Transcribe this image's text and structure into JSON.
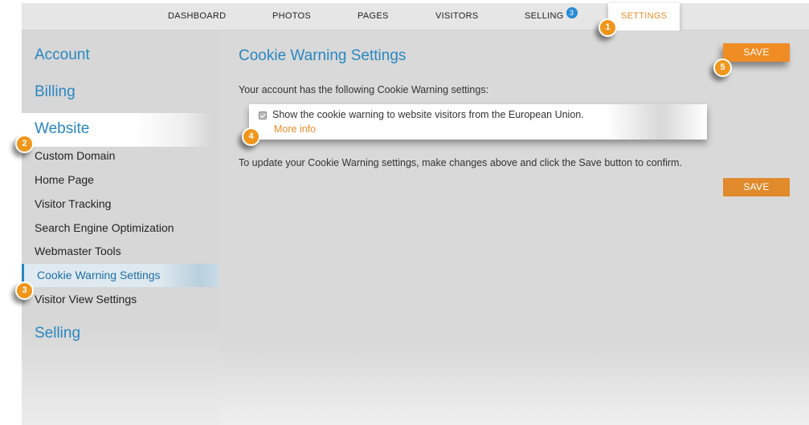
{
  "topnav": {
    "items": [
      {
        "label": "DASHBOARD"
      },
      {
        "label": "PHOTOS"
      },
      {
        "label": "PAGES"
      },
      {
        "label": "VISITORS"
      },
      {
        "label": "SELLING",
        "badge": "3"
      },
      {
        "label": "SETTINGS",
        "active": true
      }
    ]
  },
  "sidebar": {
    "headings": {
      "account": "Account",
      "billing": "Billing",
      "website": "Website",
      "selling": "Selling"
    },
    "items": [
      {
        "label": "Custom Domain"
      },
      {
        "label": "Home Page"
      },
      {
        "label": "Visitor Tracking"
      },
      {
        "label": "Search Engine Optimization"
      },
      {
        "label": "Webmaster Tools"
      },
      {
        "label": "Cookie Warning Settings",
        "active": true
      },
      {
        "label": "Visitor View Settings"
      }
    ]
  },
  "main": {
    "title": "Cookie Warning Settings",
    "intro": "Your account has the following Cookie Warning settings:",
    "cookie_option": {
      "checked": true,
      "label": "Show the cookie warning to website visitors from the European Union.",
      "more_info": "More info"
    },
    "update_text": "To update your Cookie Warning settings, make changes above and click the Save button to confirm.",
    "save_label": "SAVE"
  },
  "callouts": [
    "1",
    "2",
    "3",
    "4",
    "5"
  ],
  "colors": {
    "accent_orange": "#e98d2a",
    "link_blue": "#2a87c1",
    "badge_blue": "#2a8ad4"
  }
}
